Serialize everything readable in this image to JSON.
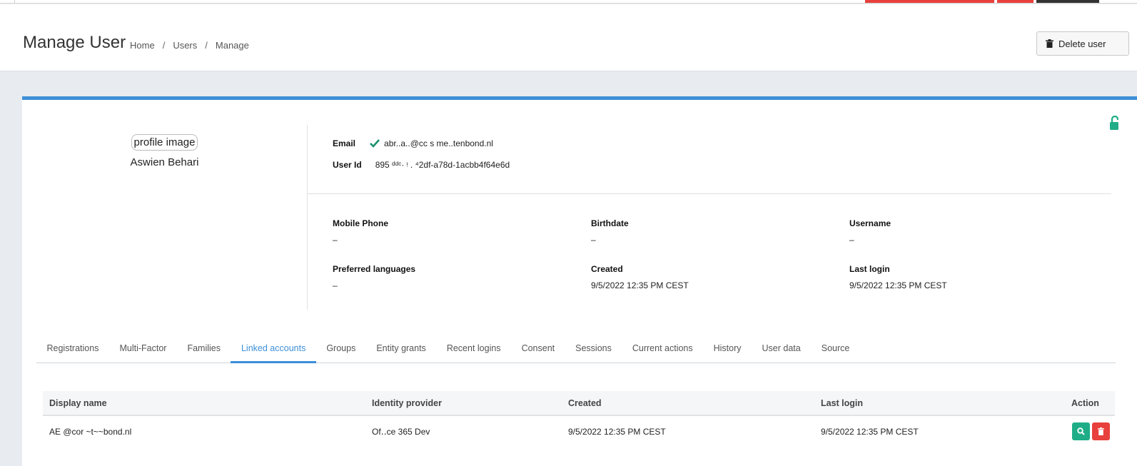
{
  "header": {
    "title": "Manage User",
    "breadcrumb": [
      "Home",
      "Users",
      "Manage"
    ],
    "delete_label": "Delete user"
  },
  "profile": {
    "image_alt": "profile image",
    "name": "Aswien Behari"
  },
  "identity": {
    "email_label": "Email",
    "email_value": "abr..a..@cc s me..tenbond.nl",
    "userid_label": "User Id",
    "userid_value": "895 ᵈᵈᶜ· ᵎ  . ⁴2df-a78d-1acbb4f64e6d"
  },
  "details": {
    "mobile_label": "Mobile Phone",
    "mobile_value": "–",
    "birthdate_label": "Birthdate",
    "birthdate_value": "–",
    "username_label": "Username",
    "username_value": "–",
    "languages_label": "Preferred languages",
    "languages_value": "–",
    "created_label": "Created",
    "created_value": "9/5/2022 12:35 PM CEST",
    "lastlogin_label": "Last login",
    "lastlogin_value": "9/5/2022 12:35 PM CEST"
  },
  "tabs": [
    "Registrations",
    "Multi-Factor",
    "Families",
    "Linked accounts",
    "Groups",
    "Entity grants",
    "Recent logins",
    "Consent",
    "Sessions",
    "Current actions",
    "History",
    "User data",
    "Source"
  ],
  "active_tab": "Linked accounts",
  "linked_table": {
    "columns": [
      "Display name",
      "Identity provider",
      "Created",
      "Last login",
      "Action"
    ],
    "rows": [
      {
        "display_name": "AE    @cor      ~t~~bond.nl",
        "identity_provider": "Of‥ce 365 Dev",
        "created": "9/5/2022 12:35 PM CEST",
        "last_login": "9/5/2022 12:35 PM CEST"
      }
    ]
  },
  "colors": {
    "accent": "#3d8fd8",
    "danger": "#e8403c",
    "success": "#1fad87"
  },
  "icons": {
    "delete": "trash-icon",
    "verified": "check-icon",
    "lock": "lock-icon",
    "view": "search-icon"
  }
}
